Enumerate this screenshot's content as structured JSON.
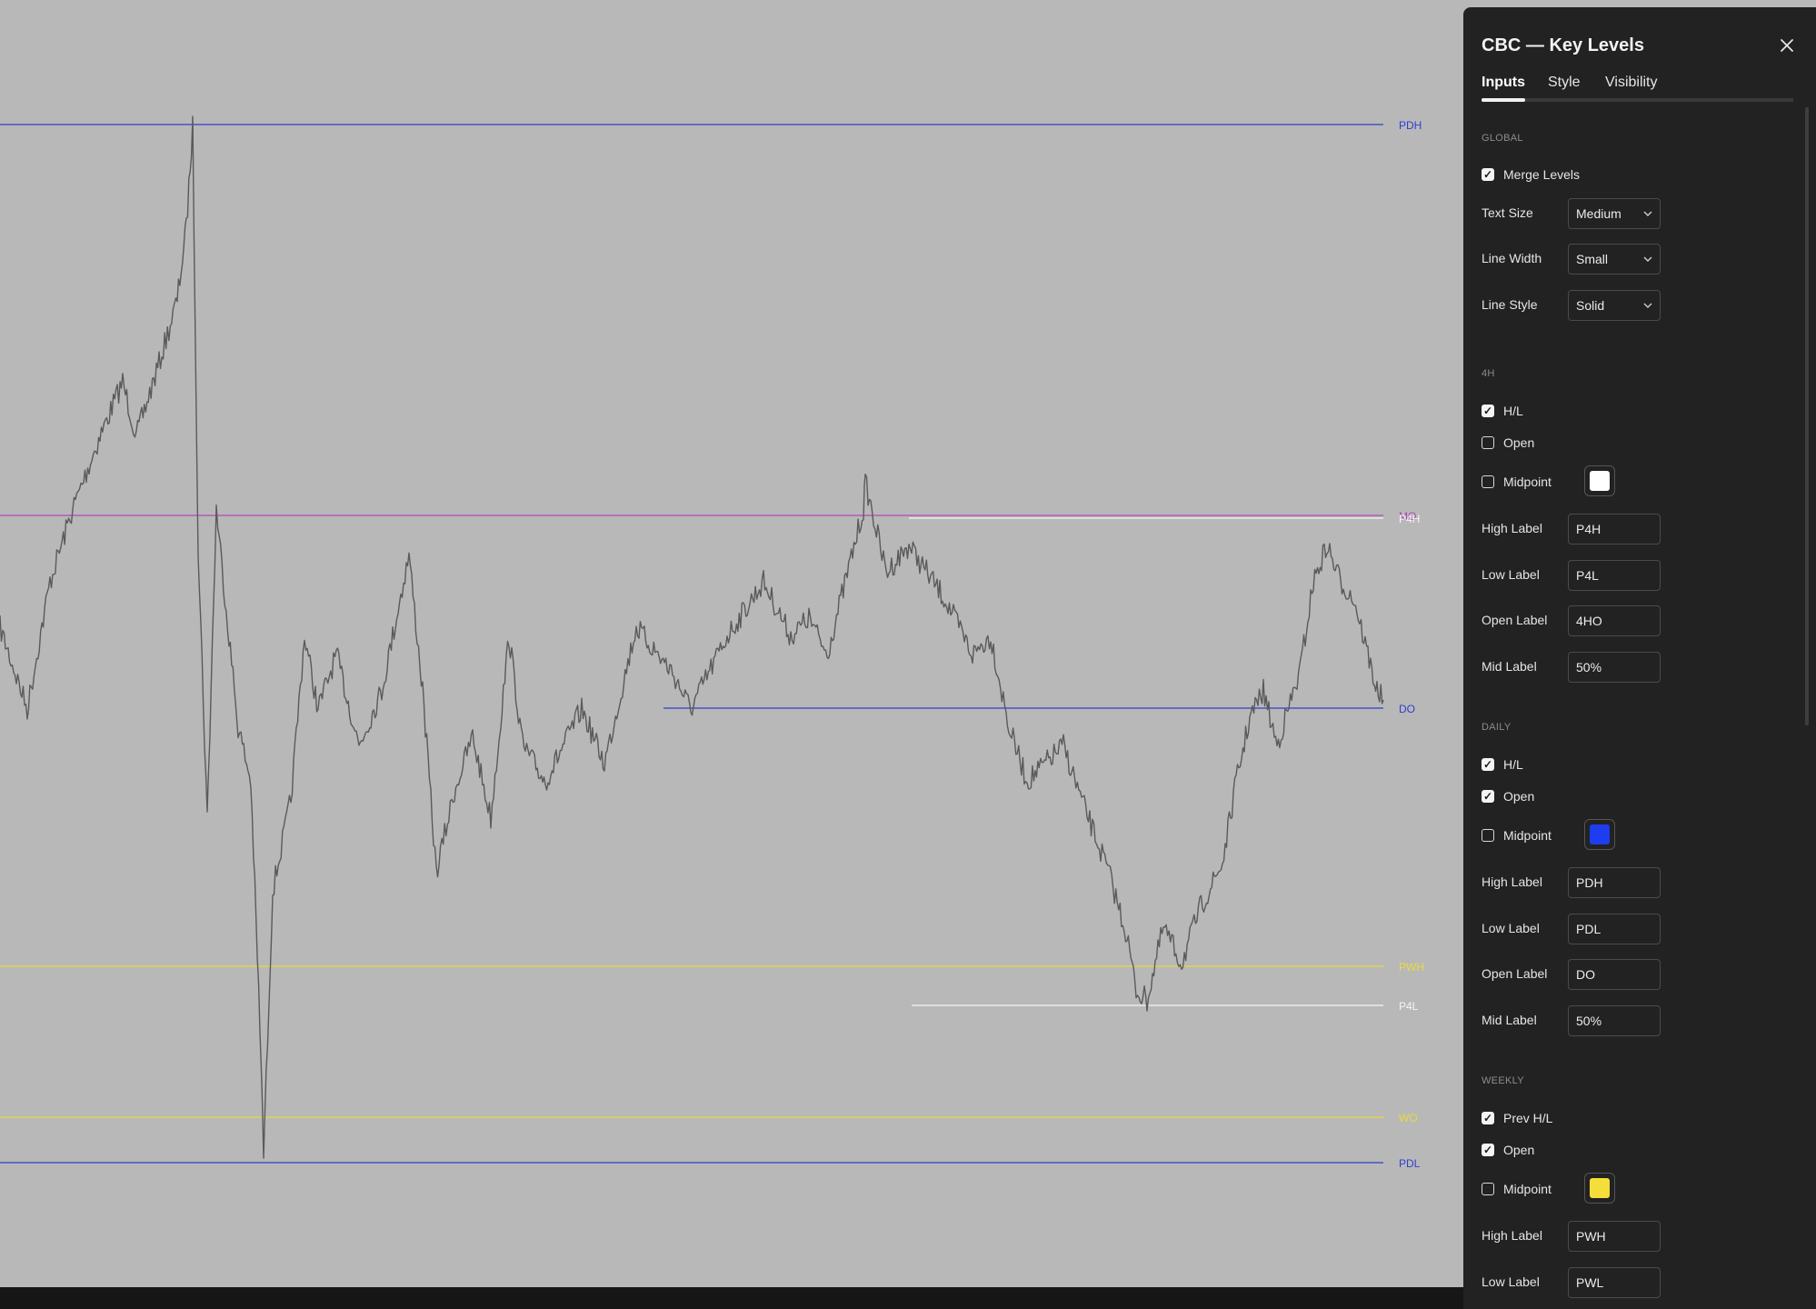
{
  "chart": {
    "background": "#b8b8b8",
    "price_color": "#5a5a5a",
    "levels": [
      {
        "label": "PDH",
        "color": "#2f3fd0"
      },
      {
        "label": "MO",
        "color": "#b04ab8"
      },
      {
        "label": "P4H",
        "color": "#f5f5f5"
      },
      {
        "label": "DO",
        "color": "#2f3fd0"
      },
      {
        "label": "PWH",
        "color": "#e8dc3a"
      },
      {
        "label": "P4L",
        "color": "#f5f5f5"
      },
      {
        "label": "WO",
        "color": "#e8dc3a"
      },
      {
        "label": "PDL",
        "color": "#2f3fd0"
      }
    ]
  },
  "panel": {
    "title": "CBC — Key Levels",
    "tabs": [
      {
        "label": "Inputs"
      },
      {
        "label": "Style"
      },
      {
        "label": "Visibility"
      }
    ],
    "global": {
      "section": "GLOBAL",
      "merge_levels": "Merge Levels",
      "text_size": {
        "label": "Text Size",
        "value": "Medium"
      },
      "line_width": {
        "label": "Line Width",
        "value": "Small"
      },
      "line_style": {
        "label": "Line Style",
        "value": "Solid"
      }
    },
    "h4": {
      "section": "4H",
      "hl": "H/L",
      "open": "Open",
      "midpoint": "Midpoint",
      "midpoint_color": "#ffffff",
      "high_label": {
        "label": "High Label",
        "value": "P4H"
      },
      "low_label": {
        "label": "Low Label",
        "value": "P4L"
      },
      "open_label": {
        "label": "Open Label",
        "value": "4HO"
      },
      "mid_label": {
        "label": "Mid Label",
        "value": "50%"
      }
    },
    "daily": {
      "section": "DAILY",
      "hl": "H/L",
      "open": "Open",
      "midpoint": "Midpoint",
      "midpoint_color": "#1e3cf0",
      "high_label": {
        "label": "High Label",
        "value": "PDH"
      },
      "low_label": {
        "label": "Low Label",
        "value": "PDL"
      },
      "open_label": {
        "label": "Open Label",
        "value": "DO"
      },
      "mid_label": {
        "label": "Mid Label",
        "value": "50%"
      }
    },
    "weekly": {
      "section": "WEEKLY",
      "hl": "Prev H/L",
      "open": "Open",
      "midpoint": "Midpoint",
      "midpoint_color": "#f5de3a",
      "high_label": {
        "label": "High Label",
        "value": "PWH"
      },
      "low_label": {
        "label": "Low Label",
        "value": "PWL"
      }
    }
  }
}
